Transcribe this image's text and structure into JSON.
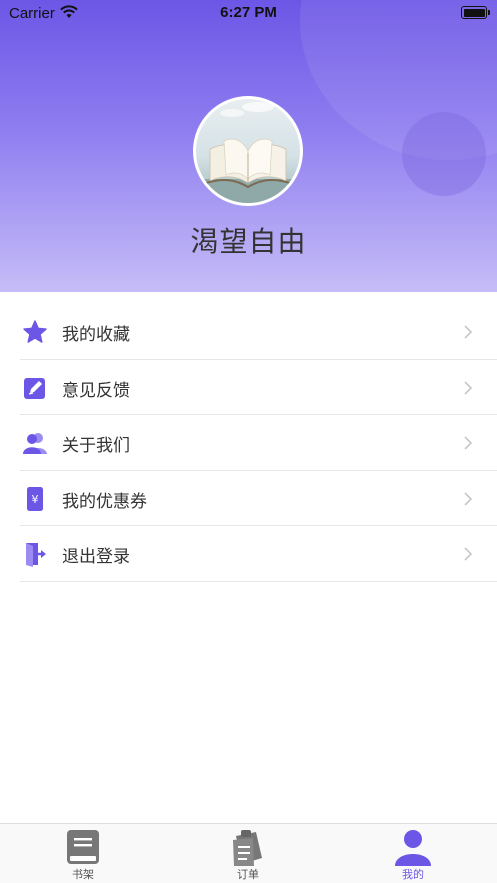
{
  "status_bar": {
    "carrier": "Carrier",
    "time": "6:27 PM"
  },
  "profile": {
    "username": "渴望自由"
  },
  "menu": {
    "items": [
      {
        "label": "我的收藏",
        "icon": "star-icon"
      },
      {
        "label": "意见反馈",
        "icon": "edit-icon"
      },
      {
        "label": "关于我们",
        "icon": "users-icon"
      },
      {
        "label": "我的优惠券",
        "icon": "coupon-icon"
      },
      {
        "label": "退出登录",
        "icon": "logout-icon"
      }
    ]
  },
  "tabbar": {
    "tabs": [
      {
        "label": "书架",
        "icon": "bookshelf-icon",
        "active": false
      },
      {
        "label": "订单",
        "icon": "order-icon",
        "active": false
      },
      {
        "label": "我的",
        "icon": "profile-icon",
        "active": true
      }
    ]
  },
  "colors": {
    "accent": "#6c56e6",
    "header_top": "#6c56e6",
    "header_bottom": "#c6bdf7"
  }
}
